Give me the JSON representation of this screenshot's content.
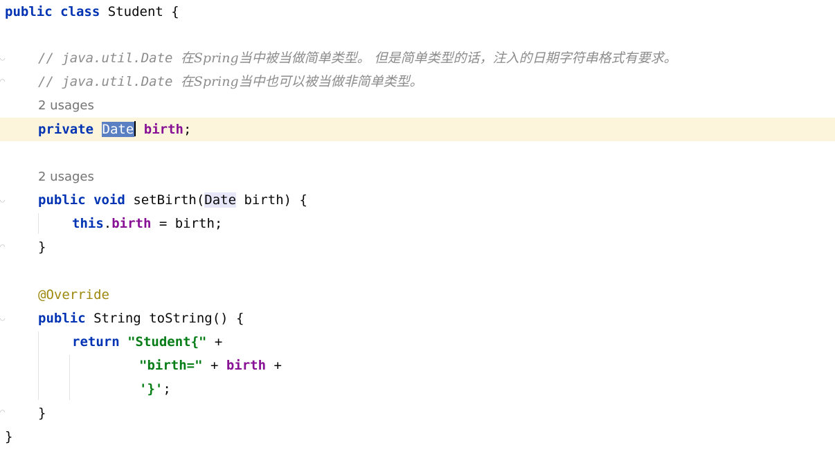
{
  "editor": {
    "class_decl": {
      "kw1": "public",
      "kw2": "class",
      "name": "Student",
      "brace": "{"
    },
    "comments": [
      {
        "prefix": "// java.util.Date ",
        "text": "在Spring当中被当做简单类型。 但是简单类型的话，注入的日期字符串格式有要求。"
      },
      {
        "prefix": "// java.util.Date ",
        "text": "在Spring当中也可以被当做非简单类型。"
      }
    ],
    "usages_1": "2 usages",
    "field": {
      "kw": "private",
      "type": "Date",
      "name": "birth",
      "semi": ";"
    },
    "usages_2": "2 usages",
    "setter": {
      "kw1": "public",
      "kw2": "void",
      "name": "setBirth(",
      "param_type": "Date",
      "param_rest": " birth) {",
      "body_kw": "this",
      "body_dot": ".",
      "body_field": "birth",
      "body_rest": " = birth;",
      "close": "}"
    },
    "annotation": "@Override",
    "tostring": {
      "kw1": "public",
      "type": "String",
      "name": "toString() {",
      "ret_kw": "return",
      "str1": "\"Student{\"",
      "plus1": " +",
      "str2": "\"birth=\"",
      "plus2": " + ",
      "field": "birth",
      "plus3": " +",
      "str3": "'}'",
      "semi": ";",
      "close": "}"
    },
    "class_close": "}"
  }
}
